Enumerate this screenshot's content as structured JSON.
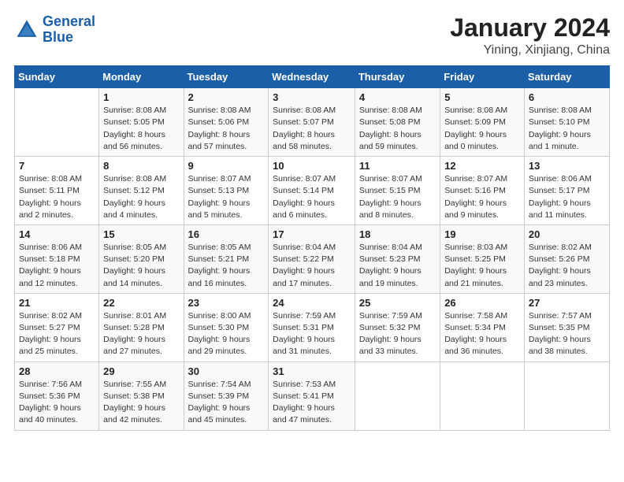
{
  "logo": {
    "text_general": "General",
    "text_blue": "Blue"
  },
  "header": {
    "title": "January 2024",
    "subtitle": "Yining, Xinjiang, China"
  },
  "weekdays": [
    "Sunday",
    "Monday",
    "Tuesday",
    "Wednesday",
    "Thursday",
    "Friday",
    "Saturday"
  ],
  "weeks": [
    [
      {
        "day": "",
        "info": ""
      },
      {
        "day": "1",
        "info": "Sunrise: 8:08 AM\nSunset: 5:05 PM\nDaylight: 8 hours\nand 56 minutes."
      },
      {
        "day": "2",
        "info": "Sunrise: 8:08 AM\nSunset: 5:06 PM\nDaylight: 8 hours\nand 57 minutes."
      },
      {
        "day": "3",
        "info": "Sunrise: 8:08 AM\nSunset: 5:07 PM\nDaylight: 8 hours\nand 58 minutes."
      },
      {
        "day": "4",
        "info": "Sunrise: 8:08 AM\nSunset: 5:08 PM\nDaylight: 8 hours\nand 59 minutes."
      },
      {
        "day": "5",
        "info": "Sunrise: 8:08 AM\nSunset: 5:09 PM\nDaylight: 9 hours\nand 0 minutes."
      },
      {
        "day": "6",
        "info": "Sunrise: 8:08 AM\nSunset: 5:10 PM\nDaylight: 9 hours\nand 1 minute."
      }
    ],
    [
      {
        "day": "7",
        "info": "Sunrise: 8:08 AM\nSunset: 5:11 PM\nDaylight: 9 hours\nand 2 minutes."
      },
      {
        "day": "8",
        "info": "Sunrise: 8:08 AM\nSunset: 5:12 PM\nDaylight: 9 hours\nand 4 minutes."
      },
      {
        "day": "9",
        "info": "Sunrise: 8:07 AM\nSunset: 5:13 PM\nDaylight: 9 hours\nand 5 minutes."
      },
      {
        "day": "10",
        "info": "Sunrise: 8:07 AM\nSunset: 5:14 PM\nDaylight: 9 hours\nand 6 minutes."
      },
      {
        "day": "11",
        "info": "Sunrise: 8:07 AM\nSunset: 5:15 PM\nDaylight: 9 hours\nand 8 minutes."
      },
      {
        "day": "12",
        "info": "Sunrise: 8:07 AM\nSunset: 5:16 PM\nDaylight: 9 hours\nand 9 minutes."
      },
      {
        "day": "13",
        "info": "Sunrise: 8:06 AM\nSunset: 5:17 PM\nDaylight: 9 hours\nand 11 minutes."
      }
    ],
    [
      {
        "day": "14",
        "info": "Sunrise: 8:06 AM\nSunset: 5:18 PM\nDaylight: 9 hours\nand 12 minutes."
      },
      {
        "day": "15",
        "info": "Sunrise: 8:05 AM\nSunset: 5:20 PM\nDaylight: 9 hours\nand 14 minutes."
      },
      {
        "day": "16",
        "info": "Sunrise: 8:05 AM\nSunset: 5:21 PM\nDaylight: 9 hours\nand 16 minutes."
      },
      {
        "day": "17",
        "info": "Sunrise: 8:04 AM\nSunset: 5:22 PM\nDaylight: 9 hours\nand 17 minutes."
      },
      {
        "day": "18",
        "info": "Sunrise: 8:04 AM\nSunset: 5:23 PM\nDaylight: 9 hours\nand 19 minutes."
      },
      {
        "day": "19",
        "info": "Sunrise: 8:03 AM\nSunset: 5:25 PM\nDaylight: 9 hours\nand 21 minutes."
      },
      {
        "day": "20",
        "info": "Sunrise: 8:02 AM\nSunset: 5:26 PM\nDaylight: 9 hours\nand 23 minutes."
      }
    ],
    [
      {
        "day": "21",
        "info": "Sunrise: 8:02 AM\nSunset: 5:27 PM\nDaylight: 9 hours\nand 25 minutes."
      },
      {
        "day": "22",
        "info": "Sunrise: 8:01 AM\nSunset: 5:28 PM\nDaylight: 9 hours\nand 27 minutes."
      },
      {
        "day": "23",
        "info": "Sunrise: 8:00 AM\nSunset: 5:30 PM\nDaylight: 9 hours\nand 29 minutes."
      },
      {
        "day": "24",
        "info": "Sunrise: 7:59 AM\nSunset: 5:31 PM\nDaylight: 9 hours\nand 31 minutes."
      },
      {
        "day": "25",
        "info": "Sunrise: 7:59 AM\nSunset: 5:32 PM\nDaylight: 9 hours\nand 33 minutes."
      },
      {
        "day": "26",
        "info": "Sunrise: 7:58 AM\nSunset: 5:34 PM\nDaylight: 9 hours\nand 36 minutes."
      },
      {
        "day": "27",
        "info": "Sunrise: 7:57 AM\nSunset: 5:35 PM\nDaylight: 9 hours\nand 38 minutes."
      }
    ],
    [
      {
        "day": "28",
        "info": "Sunrise: 7:56 AM\nSunset: 5:36 PM\nDaylight: 9 hours\nand 40 minutes."
      },
      {
        "day": "29",
        "info": "Sunrise: 7:55 AM\nSunset: 5:38 PM\nDaylight: 9 hours\nand 42 minutes."
      },
      {
        "day": "30",
        "info": "Sunrise: 7:54 AM\nSunset: 5:39 PM\nDaylight: 9 hours\nand 45 minutes."
      },
      {
        "day": "31",
        "info": "Sunrise: 7:53 AM\nSunset: 5:41 PM\nDaylight: 9 hours\nand 47 minutes."
      },
      {
        "day": "",
        "info": ""
      },
      {
        "day": "",
        "info": ""
      },
      {
        "day": "",
        "info": ""
      }
    ]
  ]
}
